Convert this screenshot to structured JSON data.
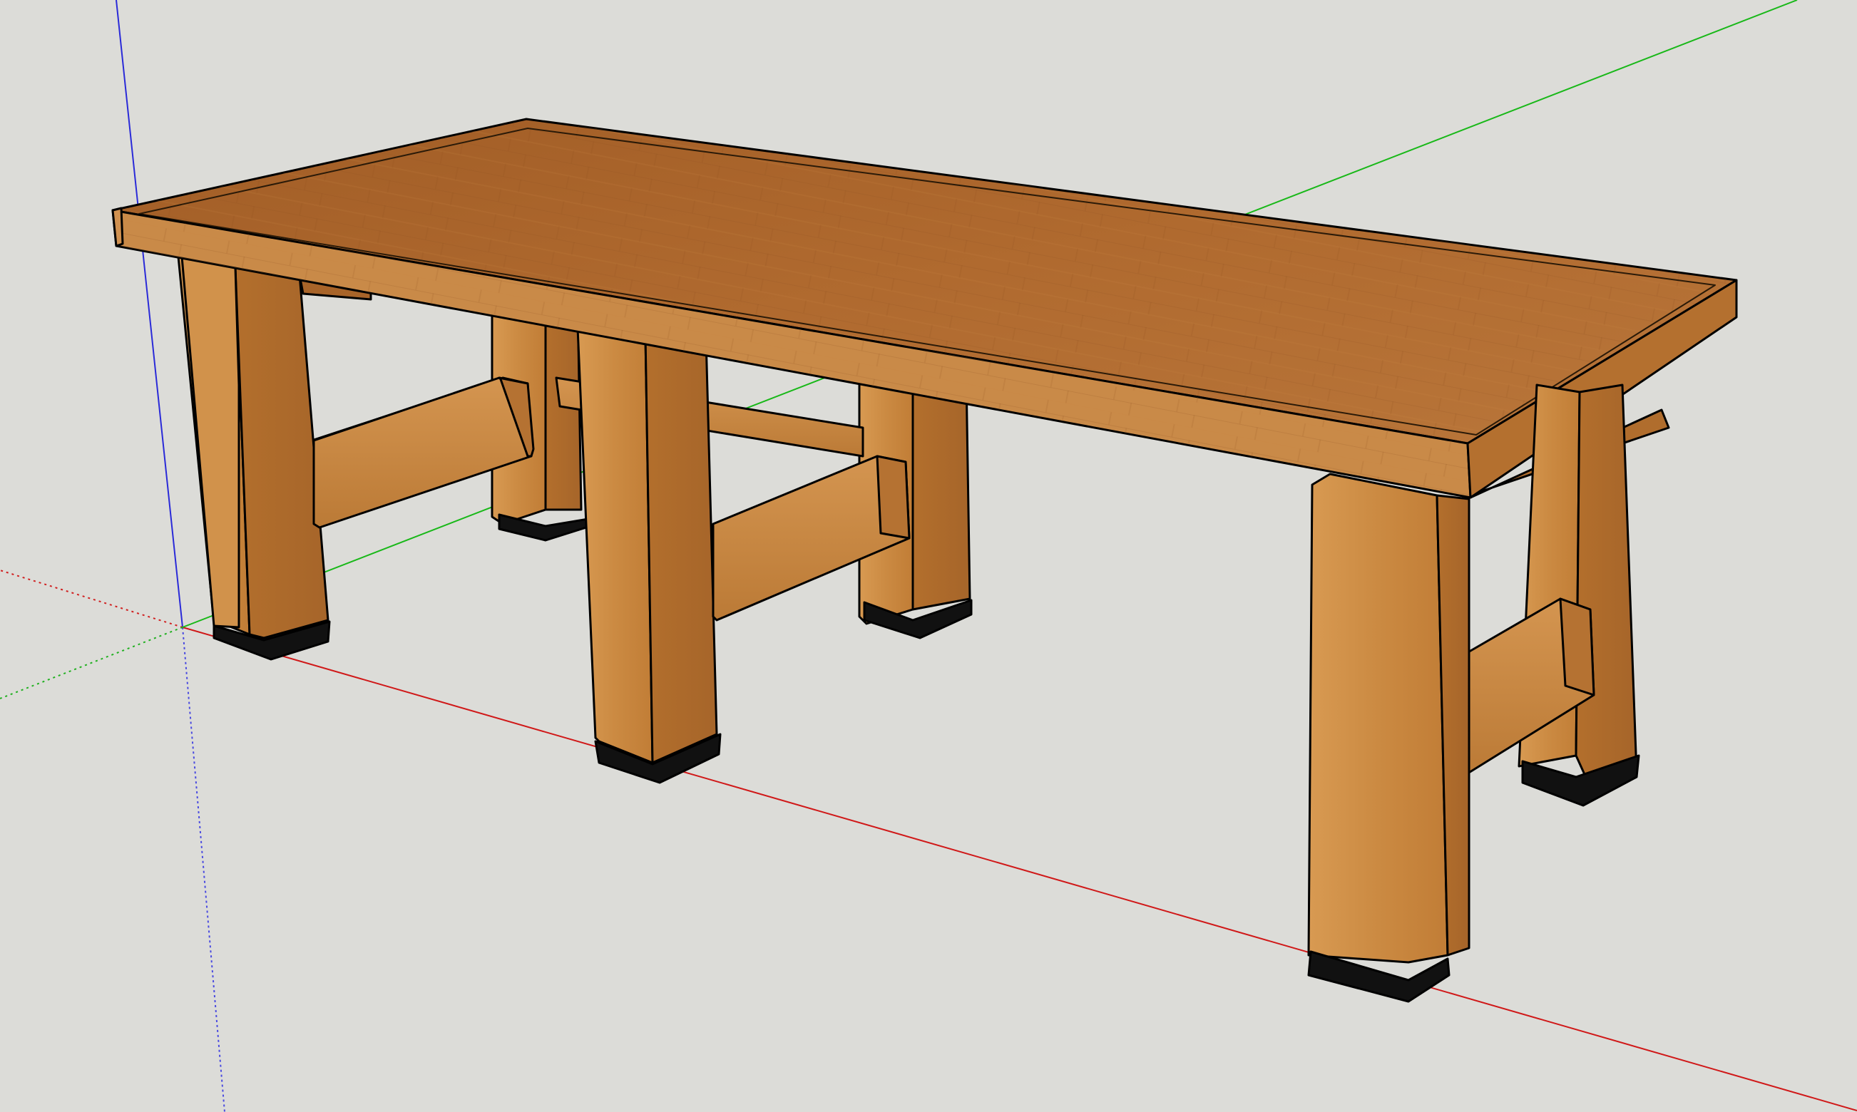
{
  "viewport": {
    "background": "#dcdcd8",
    "model": "wooden-table",
    "axes": {
      "red": "#d01010",
      "green": "#10c010",
      "blue": "#2020d0"
    },
    "wood": {
      "top": "#a9632a",
      "top_light": "#bf7a3a",
      "edge": "#c98a48",
      "leg_front": "#cf8f49",
      "leg_side": "#b8742e",
      "rail": "#c7853f",
      "foot": "#111111",
      "outline": "#000000"
    }
  }
}
